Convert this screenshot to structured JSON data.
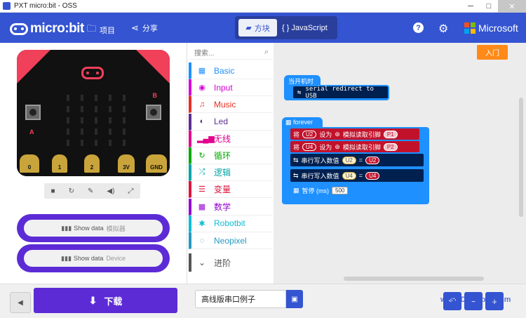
{
  "window": {
    "title": "PXT micro:bit - OSS",
    "minimize": "─",
    "maximize": "□",
    "close": "✕"
  },
  "header": {
    "logo": "micro:bit",
    "projects": "项目",
    "share": "分享",
    "tab_blocks": "方块",
    "tab_js": "{ } JavaScript",
    "help": "?",
    "microsoft": "Microsoft"
  },
  "simulator": {
    "pins": [
      "0",
      "1",
      "2",
      "3V",
      "GND"
    ],
    "button_a": "A",
    "button_b": "B",
    "show_data": [
      {
        "label": "Show data",
        "sub": "模拟器"
      },
      {
        "label": "Show data",
        "sub": "Device"
      }
    ]
  },
  "toolbox": {
    "search_placeholder": "搜索...",
    "categories": [
      {
        "label": "Basic",
        "color": "#1e90ff",
        "icon": "grid-icon"
      },
      {
        "label": "Input",
        "color": "#d400d4",
        "icon": "circle-icon"
      },
      {
        "label": "Music",
        "color": "#e63022",
        "icon": "headphones-icon"
      },
      {
        "label": "Led",
        "color": "#5c2d91",
        "icon": "toggle-icon"
      },
      {
        "label": "无线",
        "color": "#e3008c",
        "icon": "signal-icon"
      },
      {
        "label": "循环",
        "color": "#00aa00",
        "icon": "loop-icon"
      },
      {
        "label": "逻辑",
        "color": "#00a4a6",
        "icon": "shuffle-icon"
      },
      {
        "label": "变量",
        "color": "#dc143c",
        "icon": "list-icon"
      },
      {
        "label": "数学",
        "color": "#9400d3",
        "icon": "calculator-icon"
      },
      {
        "label": "Robotbit",
        "color": "#0fbcd4",
        "icon": "robot-icon"
      },
      {
        "label": "Neopixel",
        "color": "#2699bf",
        "icon": "spinner-icon"
      }
    ],
    "advanced": "进阶"
  },
  "workspace": {
    "intro": "入门",
    "on_start": "当开机时",
    "serial_redirect": "serial redirect to USB",
    "forever": "forever",
    "rows": [
      {
        "set": "将",
        "var": "U2",
        "to": "设为",
        "fn": "模拟读取引脚",
        "pin": "P1"
      },
      {
        "set": "将",
        "var": "U4",
        "to": "设为",
        "fn": "模拟读取引脚",
        "pin": "P2"
      }
    ],
    "serial_rows": [
      {
        "label": "串行写入数值",
        "key": "U2",
        "eq": "=",
        "var": "U2"
      },
      {
        "label": "串行写入数值",
        "key": "U4",
        "eq": "=",
        "var": "U4"
      }
    ],
    "pause": "暂停 (ms)",
    "pause_value": "500"
  },
  "bottom": {
    "download": "下载",
    "project_name": "高线版串口例子"
  },
  "watermark": "www.DFRobot.com"
}
